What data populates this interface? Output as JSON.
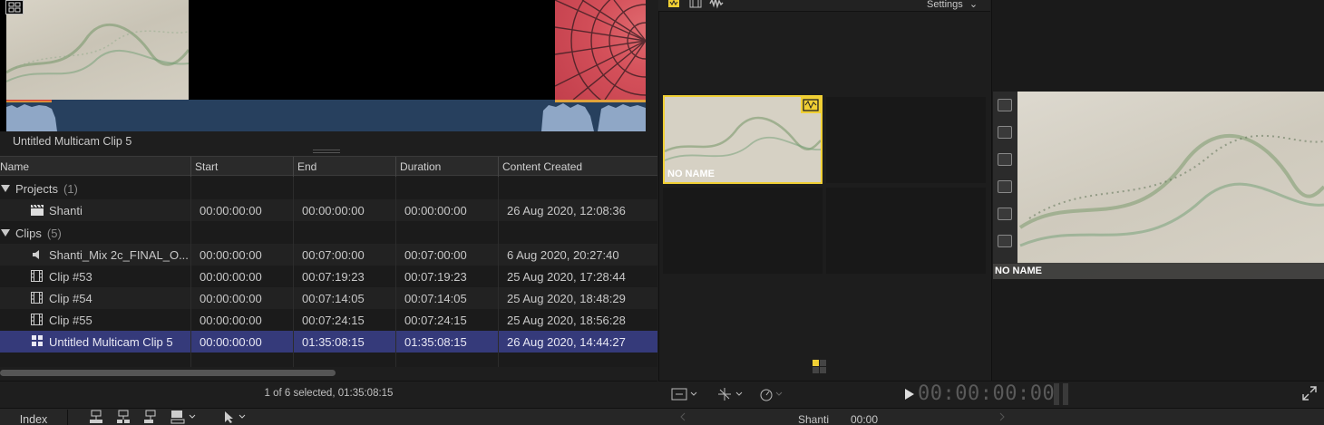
{
  "browser": {
    "clip_preview_name": "Untitled Multicam Clip 5",
    "columns": [
      "Name",
      "Start",
      "End",
      "Duration",
      "Content Created"
    ],
    "groups": [
      {
        "label": "Projects",
        "count": "(1)"
      },
      {
        "label": "Clips",
        "count": "(5)"
      }
    ],
    "rows": [
      {
        "name": "Shanti",
        "start": "00:00:00:00",
        "end": "00:00:00:00",
        "duration": "00:00:00:00",
        "created": "26 Aug 2020, 12:08:36",
        "icon": "clapper-icon"
      },
      {
        "name": "Shanti_Mix 2c_FINAL_O...",
        "start": "00:00:00:00",
        "end": "00:07:00:00",
        "duration": "00:07:00:00",
        "created": "6 Aug 2020, 20:27:40",
        "icon": "audio-icon"
      },
      {
        "name": "Clip #53",
        "start": "00:00:00:00",
        "end": "00:07:19:23",
        "duration": "00:07:19:23",
        "created": "25 Aug 2020, 17:28:44",
        "icon": "film-icon"
      },
      {
        "name": "Clip #54",
        "start": "00:00:00:00",
        "end": "00:07:14:05",
        "duration": "00:07:14:05",
        "created": "25 Aug 2020, 18:48:29",
        "icon": "film-icon"
      },
      {
        "name": "Clip #55",
        "start": "00:00:00:00",
        "end": "00:07:24:15",
        "duration": "00:07:24:15",
        "created": "25 Aug 2020, 18:56:28",
        "icon": "film-icon"
      },
      {
        "name": "Untitled Multicam Clip 5",
        "start": "00:00:00:00",
        "end": "01:35:08:15",
        "duration": "01:35:08:15",
        "created": "26 Aug 2020, 14:44:27",
        "icon": "multicam-icon"
      }
    ],
    "status": "1 of 6 selected, 01:35:08:15"
  },
  "angle_viewer": {
    "settings_label": "Settings",
    "active_angle_name": "NO NAME"
  },
  "viewer": {
    "angle_name": "NO NAME",
    "timecode": "00:00:00:00"
  },
  "timeline": {
    "index_label": "Index",
    "project_name": "Shanti",
    "project_time": "00:00"
  },
  "colors": {
    "selection": "#353a7a",
    "active_angle": "#f0cf34",
    "waveform": "#27405e"
  }
}
